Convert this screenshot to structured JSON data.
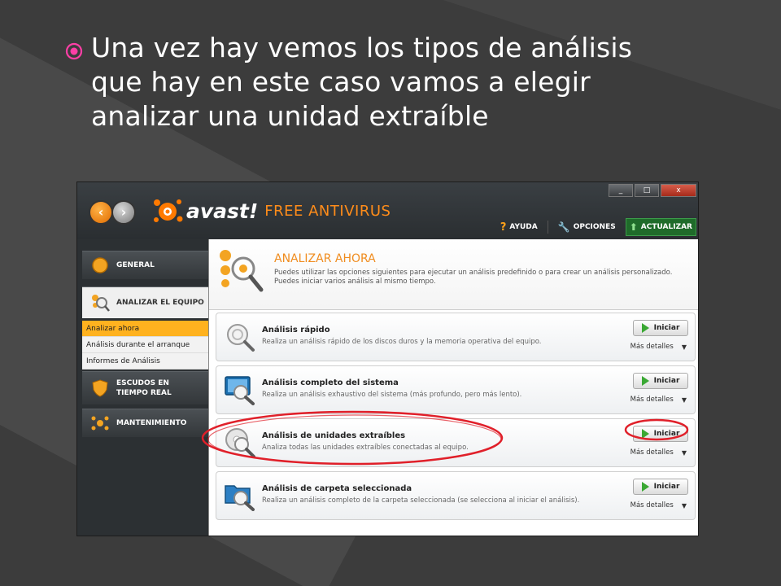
{
  "slide": {
    "bullet_icon": "target-bullet-icon",
    "text_lines": [
      "Una vez hay vemos los tipos de análisis",
      "que hay en este caso vamos a elegir",
      "analizar una unidad extraíble"
    ],
    "colors": {
      "bullet": "#ff3fa6",
      "text": "#ffffff"
    }
  },
  "window": {
    "controls": {
      "minimize": "_",
      "maximize": "□",
      "close": "x"
    },
    "logo_brand": "avast!",
    "logo_product": "FREE ANTIVIRUS",
    "toolbar": {
      "help": "AYUDA",
      "options": "OPCIONES",
      "update": "ACTUALIZAR"
    }
  },
  "sidebar": {
    "items": [
      {
        "label": "GENERAL",
        "icon": "general-icon"
      },
      {
        "label": "ANALIZAR EL EQUIPO",
        "icon": "scan-icon"
      },
      {
        "label": "ESCUDOS EN TIEMPO REAL",
        "icon": "shield-icon"
      },
      {
        "label": "MANTENIMIENTO",
        "icon": "maintenance-icon"
      }
    ],
    "sub_items": [
      {
        "label": "Analizar ahora",
        "selected": true
      },
      {
        "label": "Análisis durante el arranque",
        "selected": false
      },
      {
        "label": "Informes de Análisis",
        "selected": false
      }
    ]
  },
  "main": {
    "title": "ANALIZAR AHORA",
    "description": "Puedes utilizar las opciones siguientes para ejecutar un análisis predefinido o para crear un análisis personalizado. Puedes iniciar varios análisis al mismo tiempo.",
    "start_label": "Iniciar",
    "details_label": "Más detalles",
    "scans": [
      {
        "title": "Análisis rápido",
        "description": "Realiza un análisis rápido de los discos duros y la memoria operativa del equipo.",
        "icon": "quick-scan-icon"
      },
      {
        "title": "Análisis completo del sistema",
        "description": "Realiza un análisis exhaustivo del sistema (más profundo, pero más lento).",
        "icon": "full-scan-icon"
      },
      {
        "title": "Análisis de unidades extraíbles",
        "description": "Analiza todas las unidades extraíbles conectadas al equipo.",
        "icon": "removable-scan-icon"
      },
      {
        "title": "Análisis de carpeta seleccionada",
        "description": "Realiza un análisis completo de la carpeta seleccionada (se selecciona al iniciar el análisis).",
        "icon": "folder-scan-icon"
      }
    ]
  },
  "annotation": {
    "color": "#e0202a"
  }
}
